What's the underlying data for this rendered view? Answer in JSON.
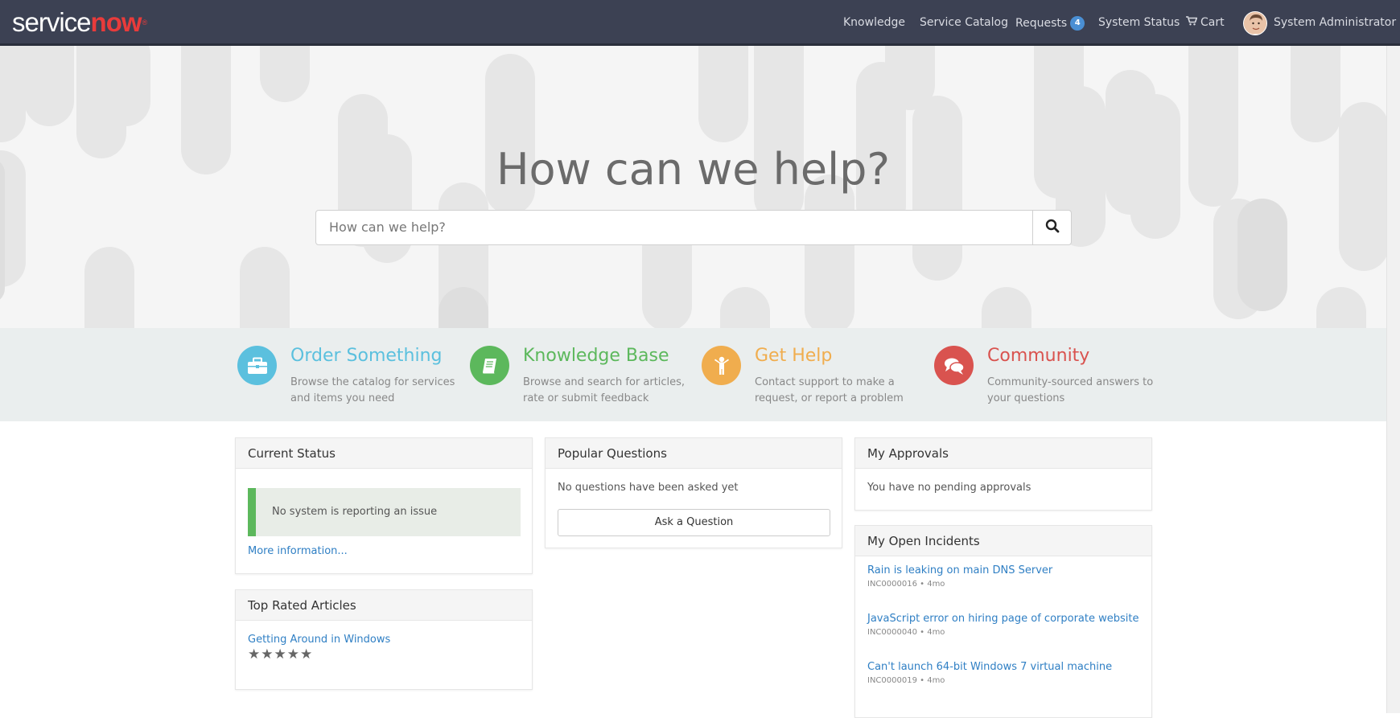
{
  "brand": {
    "service": "service",
    "now": "now",
    "reg": "®"
  },
  "nav": {
    "knowledge": "Knowledge",
    "service_catalog": "Service Catalog",
    "requests": "Requests",
    "requests_count": "4",
    "system_status": "System Status",
    "cart": "Cart",
    "user": "System Administrator"
  },
  "hero": {
    "title": "How can we help?",
    "search_placeholder": "How can we help?"
  },
  "features": [
    {
      "title": "Order Something",
      "desc": "Browse the catalog for services and items you need",
      "color": "#5bc0de",
      "icon": "briefcase-icon"
    },
    {
      "title": "Knowledge Base",
      "desc": "Browse and search for articles, rate or submit feedback",
      "color": "#5cb85c",
      "icon": "book-icon"
    },
    {
      "title": "Get Help",
      "desc": "Contact support to make a request, or report a problem",
      "color": "#f0ad4e",
      "icon": "person-raised-icon"
    },
    {
      "title": "Community",
      "desc": "Community-sourced answers to your questions",
      "color": "#d9534f",
      "icon": "chat-bubbles-icon"
    }
  ],
  "current_status": {
    "title": "Current Status",
    "message": "No system is reporting an issue",
    "more": "More information..."
  },
  "top_rated": {
    "title": "Top Rated Articles",
    "article": "Getting Around in Windows",
    "stars": "★★★★★"
  },
  "popular_questions": {
    "title": "Popular Questions",
    "empty": "No questions have been asked yet",
    "ask": "Ask a Question"
  },
  "approvals": {
    "title": "My Approvals",
    "empty": "You have no pending approvals"
  },
  "incidents": {
    "title": "My Open Incidents",
    "items": [
      {
        "title": "Rain is leaking on main DNS Server",
        "meta": "INC0000016 • 4mo"
      },
      {
        "title": "JavaScript error on hiring page of corporate website",
        "meta": "INC0000040 • 4mo"
      },
      {
        "title": "Can't launch 64-bit Windows 7 virtual machine",
        "meta": "INC0000019 • 4mo"
      }
    ]
  }
}
